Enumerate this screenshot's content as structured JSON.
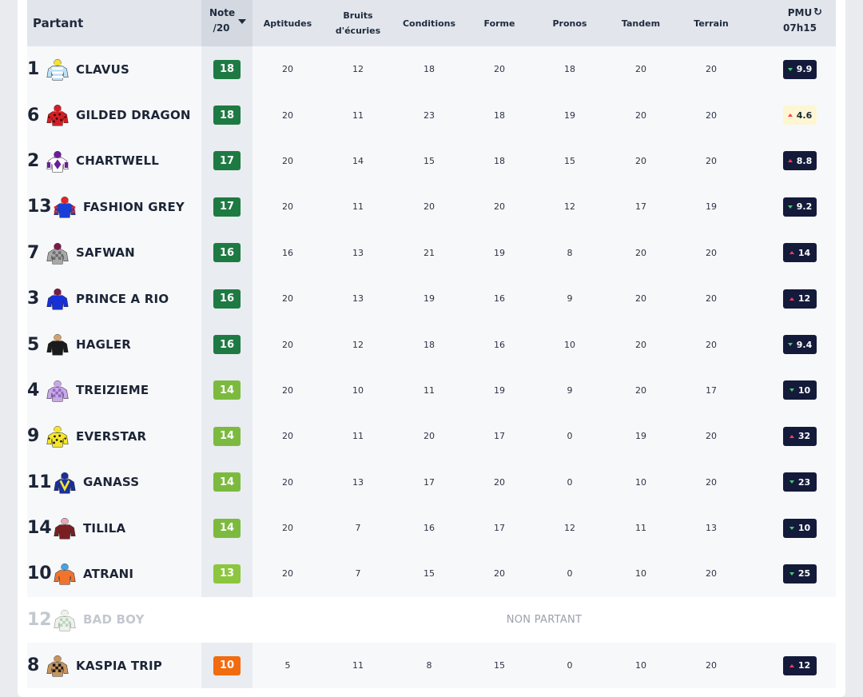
{
  "header": {
    "partant": "Partant",
    "note_line1": "Note",
    "note_line2": "/20",
    "columns": [
      {
        "l1": "Aptitudes",
        "l2": ""
      },
      {
        "l1": "Bruits",
        "l2": "d'écuries"
      },
      {
        "l1": "Conditions",
        "l2": ""
      },
      {
        "l1": "Forme",
        "l2": ""
      },
      {
        "l1": "Pronos",
        "l2": ""
      },
      {
        "l1": "Tandem",
        "l2": ""
      },
      {
        "l1": "Terrain",
        "l2": ""
      }
    ],
    "pmu_line1": "PMU",
    "pmu_line2": "07h15"
  },
  "non_partant_label": "NON PARTANT",
  "colors": {
    "note_dark": "#1e7a43",
    "note_mid": "#7cba3f",
    "note_light": "#8cc63f",
    "note_low": "#f26b0f",
    "pmu_down": "#3fd06a",
    "pmu_up": "#ff3a5a"
  },
  "rows": [
    {
      "num": "1",
      "name": "CLAVUS",
      "note": "18",
      "note_color": "#1e7a43",
      "vals": [
        "20",
        "12",
        "18",
        "20",
        "18",
        "20",
        "20"
      ],
      "pmu": "9.9",
      "trend": "down",
      "silk": {
        "body": "#bfe1f5",
        "accent": "#ffffff",
        "cap": "#f5e13c",
        "pattern": "stripes"
      }
    },
    {
      "num": "6",
      "name": "GILDED DRAGON",
      "note": "18",
      "note_color": "#1e7a43",
      "vals": [
        "20",
        "11",
        "23",
        "18",
        "19",
        "20",
        "20"
      ],
      "pmu": "4.6",
      "trend": "up",
      "pmu_style": "light",
      "silk": {
        "body": "#d41e24",
        "accent": "#3a0b0b",
        "cap": "#d41e24",
        "pattern": "spots"
      }
    },
    {
      "num": "2",
      "name": "CHARTWELL",
      "note": "17",
      "note_color": "#1e7a43",
      "vals": [
        "20",
        "14",
        "15",
        "18",
        "15",
        "20",
        "20"
      ],
      "pmu": "8.8",
      "trend": "up",
      "silk": {
        "body": "#ffffff",
        "accent": "#6a1d9a",
        "cap": "#6a1d9a",
        "pattern": "diamond"
      }
    },
    {
      "num": "13",
      "name": "FASHION GREY",
      "note": "17",
      "note_color": "#1e7a43",
      "vals": [
        "20",
        "11",
        "20",
        "20",
        "12",
        "17",
        "19"
      ],
      "pmu": "9.2",
      "trend": "down",
      "silk": {
        "body": "#1a3fd6",
        "accent": "#e8232a",
        "cap": "#e8232a",
        "pattern": "sleeves"
      }
    },
    {
      "num": "7",
      "name": "SAFWAN",
      "note": "16",
      "note_color": "#1e7a43",
      "vals": [
        "16",
        "13",
        "21",
        "19",
        "8",
        "20",
        "20"
      ],
      "pmu": "14",
      "trend": "up",
      "silk": {
        "body": "#a9a9a9",
        "accent": "#6b6b6b",
        "cap": "#7a1a4a",
        "pattern": "check"
      }
    },
    {
      "num": "3",
      "name": "PRINCE A RIO",
      "note": "16",
      "note_color": "#1e7a43",
      "vals": [
        "20",
        "13",
        "19",
        "16",
        "9",
        "20",
        "20"
      ],
      "pmu": "12",
      "trend": "up",
      "silk": {
        "body": "#1730d8",
        "accent": "#0f1fa0",
        "cap": "#7a1a4a",
        "pattern": "plain"
      }
    },
    {
      "num": "5",
      "name": "HAGLER",
      "note": "16",
      "note_color": "#1e7a43",
      "vals": [
        "20",
        "12",
        "18",
        "16",
        "10",
        "20",
        "20"
      ],
      "pmu": "9.4",
      "trend": "down",
      "silk": {
        "body": "#1b1b1b",
        "accent": "#444444",
        "cap": "#d4a36c",
        "pattern": "plain"
      }
    },
    {
      "num": "4",
      "name": "TREIZIEME",
      "note": "14",
      "note_color": "#7cba3f",
      "vals": [
        "20",
        "10",
        "11",
        "19",
        "9",
        "20",
        "17"
      ],
      "pmu": "10",
      "trend": "down",
      "silk": {
        "body": "#c9a8e8",
        "accent": "#8f6cc0",
        "cap": "#c9a8e8",
        "pattern": "check"
      }
    },
    {
      "num": "9",
      "name": "EVERSTAR",
      "note": "14",
      "note_color": "#7cba3f",
      "vals": [
        "20",
        "11",
        "20",
        "17",
        "0",
        "19",
        "20"
      ],
      "pmu": "32",
      "trend": "up",
      "silk": {
        "body": "#f5e629",
        "accent": "#1b1b1b",
        "cap": "#f5e629",
        "pattern": "spots"
      }
    },
    {
      "num": "11",
      "name": "GANASS",
      "note": "14",
      "note_color": "#7cba3f",
      "vals": [
        "20",
        "13",
        "17",
        "20",
        "0",
        "10",
        "20"
      ],
      "pmu": "23",
      "trend": "down",
      "silk": {
        "body": "#1a2f9e",
        "accent": "#f5e629",
        "cap": "#1a2f9e",
        "pattern": "vee"
      }
    },
    {
      "num": "14",
      "name": "TILILA",
      "note": "14",
      "note_color": "#7cba3f",
      "vals": [
        "20",
        "7",
        "16",
        "17",
        "12",
        "11",
        "13"
      ],
      "pmu": "10",
      "trend": "down",
      "silk": {
        "body": "#7a1e22",
        "accent": "#e9a7b8",
        "cap": "#e9a7b8",
        "pattern": "plain"
      }
    },
    {
      "num": "10",
      "name": "ATRANI",
      "note": "13",
      "note_color": "#8cc63f",
      "vals": [
        "20",
        "7",
        "15",
        "20",
        "0",
        "10",
        "20"
      ],
      "pmu": "25",
      "trend": "down",
      "silk": {
        "body": "#f2732b",
        "accent": "#f9b487",
        "cap": "#4aa3e0",
        "pattern": "plain"
      }
    },
    {
      "num": "12",
      "name": "BAD BOY",
      "nonpartant": true,
      "silk": {
        "body": "#dfe8de",
        "accent": "#7fb57f",
        "cap": "#dfe8de",
        "pattern": "check"
      }
    },
    {
      "num": "8",
      "name": "KASPIA TRIP",
      "note": "10",
      "note_color": "#f26b0f",
      "vals": [
        "5",
        "11",
        "8",
        "15",
        "0",
        "10",
        "20"
      ],
      "pmu": "12",
      "trend": "up",
      "silk": {
        "body": "#c7955e",
        "accent": "#1b1b1b",
        "cap": "#c7955e",
        "pattern": "check"
      }
    }
  ]
}
